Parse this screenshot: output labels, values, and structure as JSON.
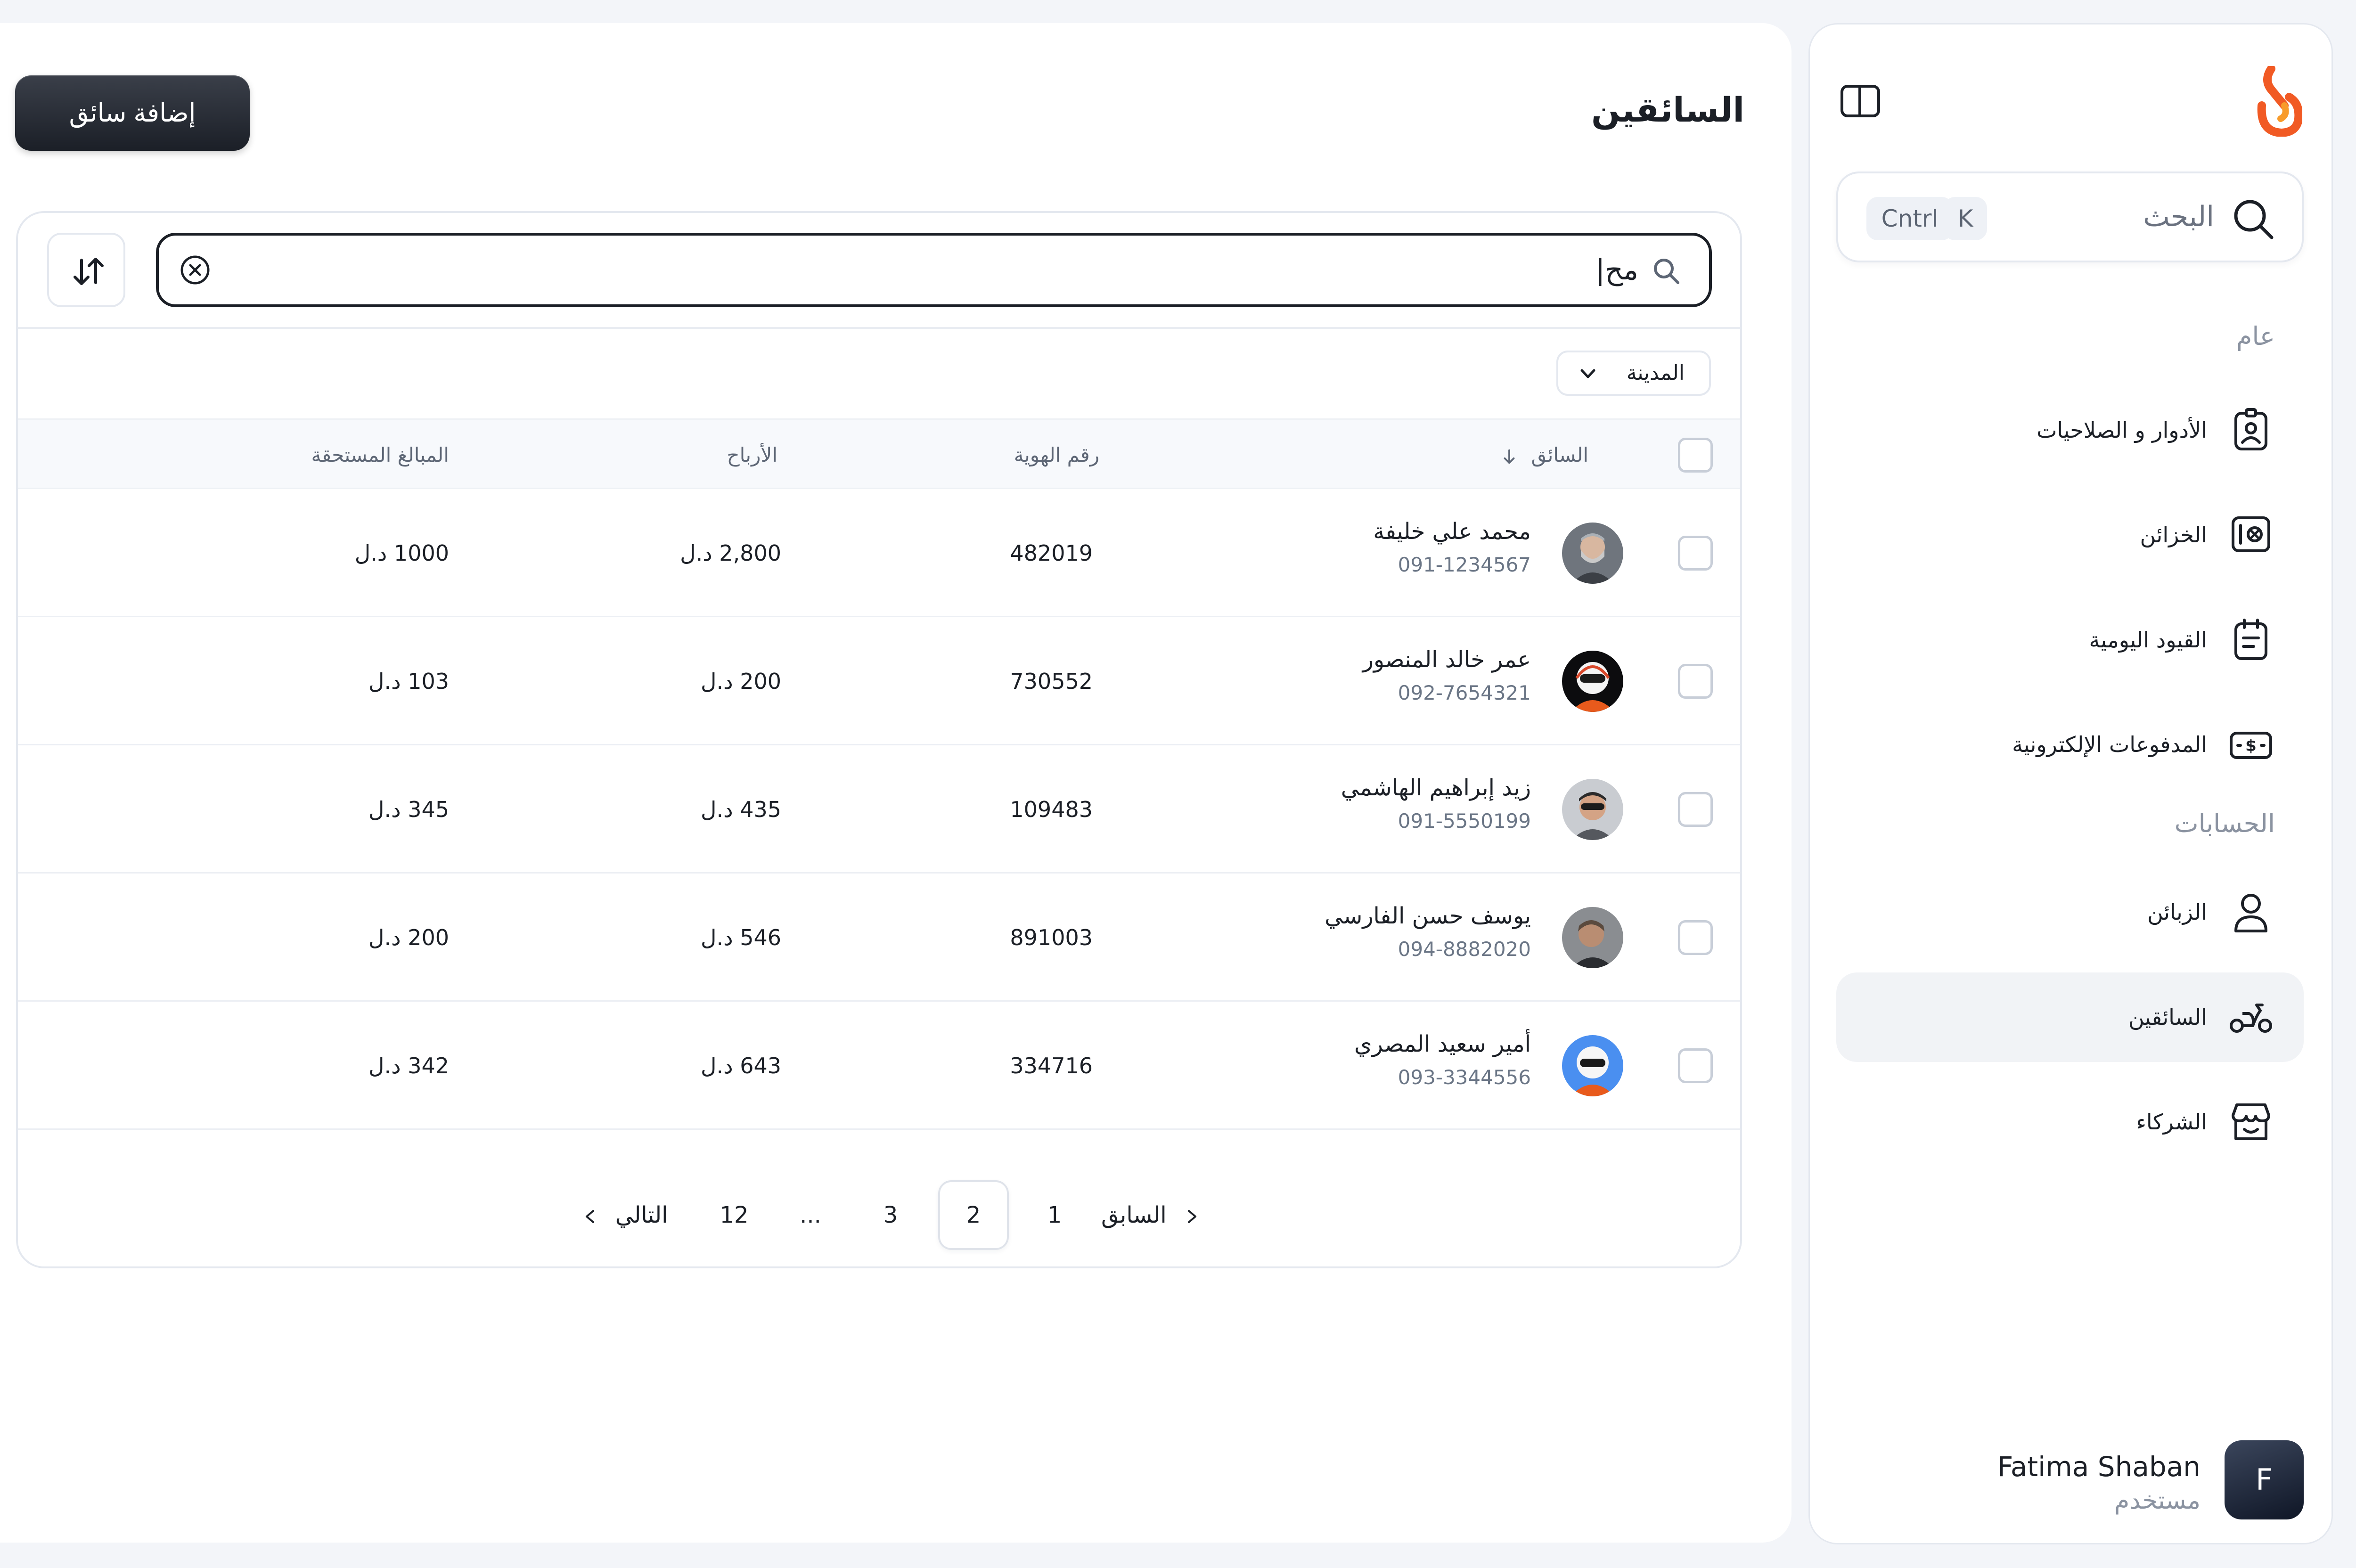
{
  "sidebar": {
    "search": {
      "label": "البحث",
      "shortcut_key": "K",
      "shortcut_mod": "Cntrl"
    },
    "sections": [
      {
        "title": "عام",
        "items": [
          {
            "label": "الأدوار و الصلاحيات",
            "icon": "id-badge-icon"
          },
          {
            "label": "الخزائن",
            "icon": "safe-icon"
          },
          {
            "label": "القيود اليومية",
            "icon": "notebook-icon"
          },
          {
            "label": "المدفوعات الإلكترونية",
            "icon": "cash-icon"
          }
        ]
      },
      {
        "title": "الحسابات",
        "items": [
          {
            "label": "الزبائن",
            "icon": "user-icon"
          },
          {
            "label": "السائقين",
            "icon": "scooter-icon",
            "active": true
          },
          {
            "label": "الشركاء",
            "icon": "store-icon"
          }
        ]
      }
    ],
    "user": {
      "initial": "F",
      "name": "Fatima Shaban",
      "role": "مستخدم"
    }
  },
  "main": {
    "title": "السائقين",
    "add_button": "إضافة سائق",
    "search_value": "مح|",
    "city_filter": "المدينة",
    "columns": {
      "driver": "السائق",
      "id_number": "رقم الهوية",
      "earnings": "الأرباح",
      "due_amount": "المبالغ المستحقة"
    },
    "rows": [
      {
        "name": "محمد علي خليفة",
        "phone": "091-1234567",
        "id": "482019",
        "earnings": "2,800 د.ل",
        "due": "1000 د.ل",
        "avatar": "gray-beard"
      },
      {
        "name": "عمر خالد المنصور",
        "phone": "092-7654321",
        "id": "730552",
        "earnings": "200 د.ل",
        "due": "103 د.ل",
        "avatar": "helmet-dark"
      },
      {
        "name": "زيد إبراهيم الهاشمي",
        "phone": "091-5550199",
        "id": "109483",
        "earnings": "435 د.ل",
        "due": "345 د.ل",
        "avatar": "sunglasses"
      },
      {
        "name": "يوسف حسن الفارسي",
        "phone": "094-8882020",
        "id": "891003",
        "earnings": "546 د.ل",
        "due": "200 د.ل",
        "avatar": "rider-gray"
      },
      {
        "name": "أمير سعيد المصري",
        "phone": "093-3344556",
        "id": "334716",
        "earnings": "643 د.ل",
        "due": "342 د.ل",
        "avatar": "helmet-blue"
      }
    ],
    "pagination": {
      "prev": "السابق",
      "next": "التالي",
      "pages": [
        "1",
        "2",
        "3",
        "...",
        "12"
      ],
      "current": "2"
    }
  },
  "colors": {
    "accent": "#F15A24",
    "dark_button": "#1B1F27",
    "border": "#E4E8EF",
    "muted_text": "#8B93A1"
  }
}
